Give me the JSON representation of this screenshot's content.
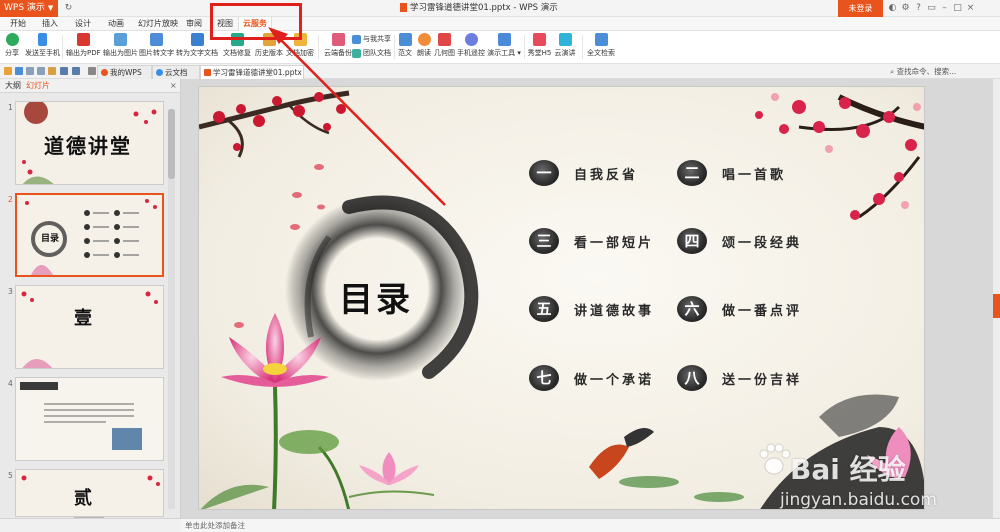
{
  "titlebar": {
    "app_name": "WPS 演示",
    "caret": "▼",
    "doc_title": "学习雷锋道德讲堂01.pptx - WPS 演示",
    "login_label": "未登录"
  },
  "menu_tabs": [
    "开始",
    "插入",
    "设计",
    "动画",
    "幻灯片放映",
    "审阅",
    "视图",
    "云服务"
  ],
  "ribbon": {
    "share": "分享",
    "send_phone": "发送至手机",
    "export_pdf": "输出为PDF",
    "export_img": "输出为图片",
    "img_to_text": "图片转文字",
    "to_doc": "转为文字文档",
    "repair": "文档修复",
    "history": "历史版本",
    "encrypt": "文档加密",
    "cloud_backup": "云端备份",
    "shared_with_me": "与我共享",
    "team_docs": "团队文档",
    "template": "范文",
    "read_aloud": "朗读",
    "geometry": "几何图",
    "phone_remote": "手机遥控",
    "present_tools": "演示工具 ▾",
    "xiu_h5": "秀堂H5",
    "cloud_speech": "云演讲",
    "fulltext_check": "全文检索"
  },
  "doc_tabs": {
    "mywps": "我的WPS",
    "cloud_docs": "云文档",
    "current": "学习雷锋道德讲堂01.pptx"
  },
  "quick_right": "查找命令、搜索...",
  "left_panel": {
    "tab_outline": "大纲",
    "tab_slides": "幻灯片",
    "close": "×",
    "add": "+",
    "slide_numbers": [
      "1",
      "2",
      "3",
      "4",
      "5"
    ],
    "thumb1_title": "道德讲堂",
    "thumb2_title": "目录",
    "thumb3_char": "壹",
    "thumb5_char": "贰"
  },
  "slide": {
    "title": "目录",
    "items": [
      {
        "num": "一",
        "text": "自我反省"
      },
      {
        "num": "二",
        "text": "唱一首歌"
      },
      {
        "num": "三",
        "text": "看一部短片"
      },
      {
        "num": "四",
        "text": "颂一段经典"
      },
      {
        "num": "五",
        "text": "讲道德故事"
      },
      {
        "num": "六",
        "text": "做一番点评"
      },
      {
        "num": "七",
        "text": "做一个承诺"
      },
      {
        "num": "八",
        "text": "送一份吉祥"
      }
    ]
  },
  "notes_placeholder": "单击此处添加备注",
  "watermark": {
    "main": "Bai 经验",
    "url": "jingyan.baidu.com"
  },
  "colors": {
    "accent": "#e8541c",
    "annotation": "#e0201a"
  }
}
